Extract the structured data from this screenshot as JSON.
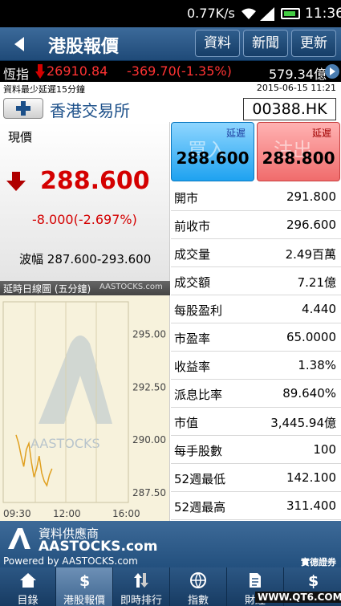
{
  "statusbar": {
    "net_speed": "0.77K/s",
    "time": "11:36"
  },
  "header": {
    "title": "港股報價",
    "buttons": [
      "資料",
      "新聞",
      "更新"
    ]
  },
  "index_bar": {
    "name": "恆指",
    "value": "26910.84",
    "change": "-369.70(-1.35%)",
    "turnover": "579.34億"
  },
  "quote": {
    "delay_note": "資料最少延遲15分鐘",
    "datetime": "2015-06-15 11:21",
    "exchange": "香港交易所",
    "stock_code": "00388.HK",
    "now_label": "現價",
    "price": "288.600",
    "change": "-8.000(-2.697%)",
    "range_label": "波幅",
    "range": "287.600-293.600",
    "bid": {
      "delay": "延遲",
      "label": "買入",
      "value": "288.600"
    },
    "ask": {
      "delay": "延遲",
      "label": "沽出",
      "value": "288.800"
    }
  },
  "stats": [
    {
      "label": "開市",
      "value": "291.800"
    },
    {
      "label": "前收市",
      "value": "296.600"
    },
    {
      "label": "成交量",
      "value": "2.49百萬"
    },
    {
      "label": "成交額",
      "value": "7.21億"
    },
    {
      "label": "每股盈利",
      "value": "4.440"
    },
    {
      "label": "市盈率",
      "value": "65.0000"
    },
    {
      "label": "收益率",
      "value": "1.38%"
    },
    {
      "label": "派息比率",
      "value": "89.640%"
    },
    {
      "label": "市值",
      "value": "3,445.94億"
    },
    {
      "label": "每手股數",
      "value": "100"
    },
    {
      "label": "52週最低",
      "value": "142.100"
    },
    {
      "label": "52週最高",
      "value": "311.400"
    }
  ],
  "chart_data": {
    "type": "line",
    "title": "延時日線圖 (五分鐘)",
    "source_label": "AASTOCKS.com",
    "watermark": "AASTOCKS",
    "x_ticks": [
      "09:30",
      "12:00",
      "16:00"
    ],
    "y_ticks": [
      295.0,
      292.5,
      290.0,
      287.5
    ],
    "ylim": [
      287.0,
      296.5
    ],
    "series": [
      {
        "values": [
          290.2,
          289.8,
          289.2,
          288.7,
          289.5,
          289.8,
          288.9,
          288.2,
          288.6,
          289.2,
          288.4,
          288.0,
          287.8,
          288.3,
          288.6
        ]
      }
    ]
  },
  "provider": {
    "line1": "資料供應商",
    "line2": "AASTOCKS.com",
    "line3": "Powered by AASTOCKS.com",
    "right": "實德證券"
  },
  "tabs": [
    {
      "label": "目錄",
      "icon": "home-icon"
    },
    {
      "label": "港股報價",
      "icon": "dollar-icon",
      "active": true
    },
    {
      "label": "即時排行",
      "icon": "sort-icon"
    },
    {
      "label": "指數",
      "icon": "globe-icon"
    },
    {
      "label": "財經",
      "icon": "document-icon"
    },
    {
      "label": "",
      "icon": "dollar-icon"
    }
  ],
  "watermark_text": "WWW.QT6.COM",
  "colors": {
    "header": "#2a5885",
    "down": "#d40000",
    "bid": "#1ea2f0",
    "ask": "#f06c6c"
  }
}
